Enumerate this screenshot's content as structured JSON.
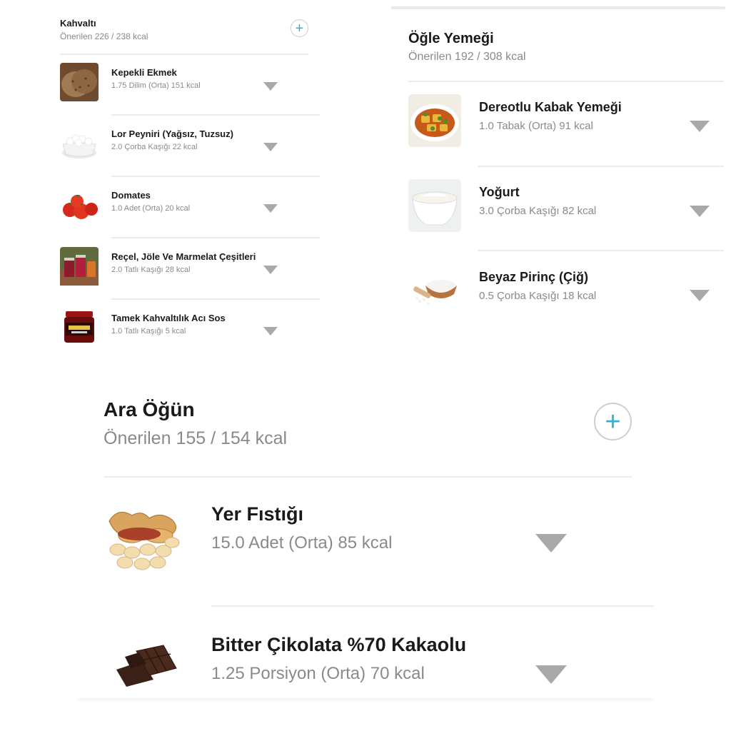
{
  "breakfast": {
    "title": "Kahvaltı",
    "subtitle": "Önerilen 226 / 238 kcal",
    "add_icon": "plus-icon",
    "items": [
      {
        "name": "Kepekli Ekmek",
        "detail": "1.75 Dilim (Orta) 151 kcal"
      },
      {
        "name": "Lor Peyniri (Yağsız, Tuzsuz)",
        "detail": "2.0 Çorba Kaşığı 22 kcal"
      },
      {
        "name": "Domates",
        "detail": "1.0 Adet (Orta) 20 kcal"
      },
      {
        "name": "Reçel, Jöle Ve Marmelat Çeşitleri",
        "detail": "2.0 Tatlı Kaşığı 28 kcal"
      },
      {
        "name": "Tamek Kahvaltılık Acı Sos",
        "detail": "1.0 Tatlı Kaşığı 5 kcal"
      }
    ]
  },
  "lunch": {
    "title": "Öğle Yemeği",
    "subtitle": "Önerilen 192 / 308 kcal",
    "items": [
      {
        "name": "Dereotlu Kabak Yemeği",
        "detail": "1.0 Tabak (Orta) 91 kcal"
      },
      {
        "name": "Yoğurt",
        "detail": "3.0 Çorba Kaşığı 82 kcal"
      },
      {
        "name": "Beyaz Pirinç (Çiğ)",
        "detail": "0.5 Çorba Kaşığı 18 kcal"
      }
    ]
  },
  "snack": {
    "title": "Ara Öğün",
    "subtitle": "Önerilen 155 / 154 kcal",
    "add_icon": "plus-icon",
    "items": [
      {
        "name": "Yer Fıstığı",
        "detail": "15.0 Adet (Orta) 85 kcal"
      },
      {
        "name": "Bitter Çikolata %70 Kakaolu",
        "detail": "1.25 Porsiyon (Orta) 70 kcal"
      }
    ]
  },
  "colors": {
    "accent": "#2ab4d9",
    "divider": "#ececec",
    "caret": "#a9a9a9"
  },
  "icons": {
    "expand": "caret-down-icon",
    "add": "plus-icon"
  }
}
